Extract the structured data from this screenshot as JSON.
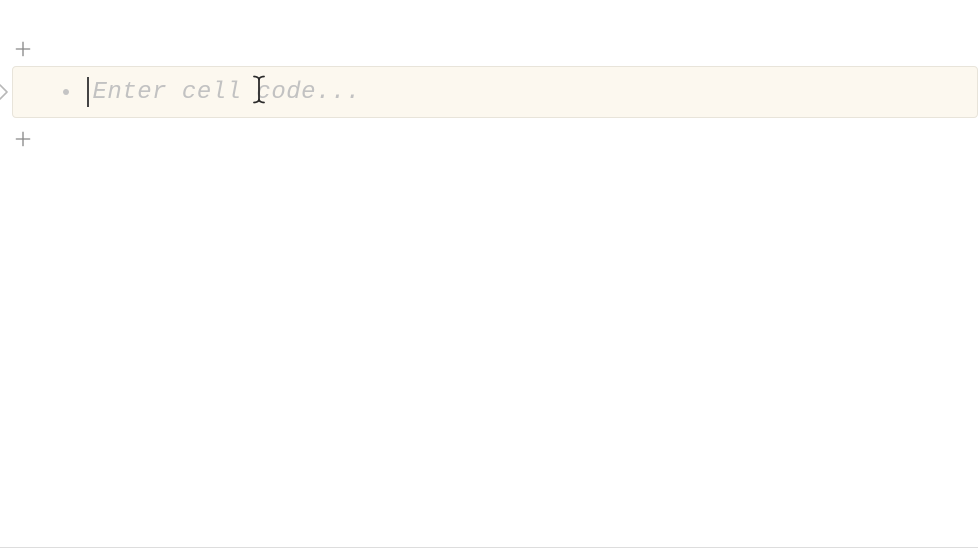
{
  "cell": {
    "placeholder": "Enter cell code...",
    "value": ""
  },
  "icons": {
    "add_above": "plus-icon",
    "add_below": "plus-icon",
    "run": "chevron-right-icon"
  }
}
